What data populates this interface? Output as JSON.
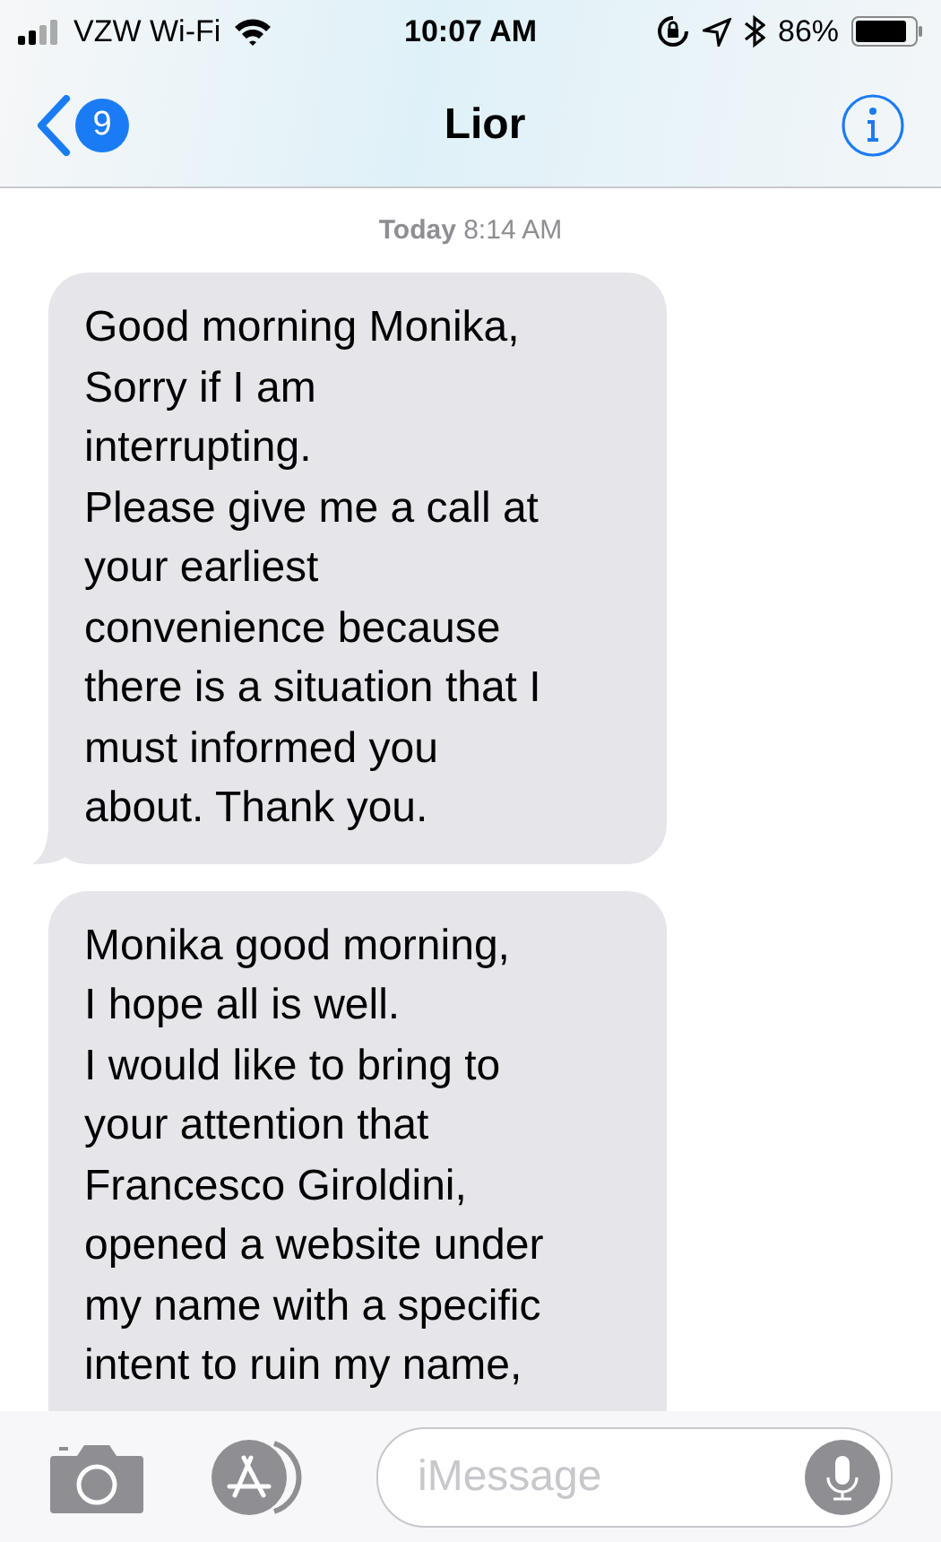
{
  "status_bar": {
    "carrier": "VZW Wi-Fi",
    "time": "10:07 AM",
    "battery": "86%"
  },
  "nav": {
    "unread": "9",
    "title": "Lior"
  },
  "timestamp": {
    "day": "Today",
    "time": "8:14 AM"
  },
  "messages": [
    {
      "text": "Good morning Monika,\nSorry if I am\ninterrupting.\nPlease give me a call at\nyour earliest\nconvenience because\nthere is a situation that I\nmust informed you\nabout. Thank you.",
      "tail": true
    },
    {
      "text": "Monika good morning,\nI hope all is well.\nI would like to bring to\nyour attention that\nFrancesco Giroldini,\nopened a website under\nmy name with a specific\nintent to ruin my name,",
      "tail": false
    }
  ],
  "input": {
    "placeholder": "iMessage"
  }
}
